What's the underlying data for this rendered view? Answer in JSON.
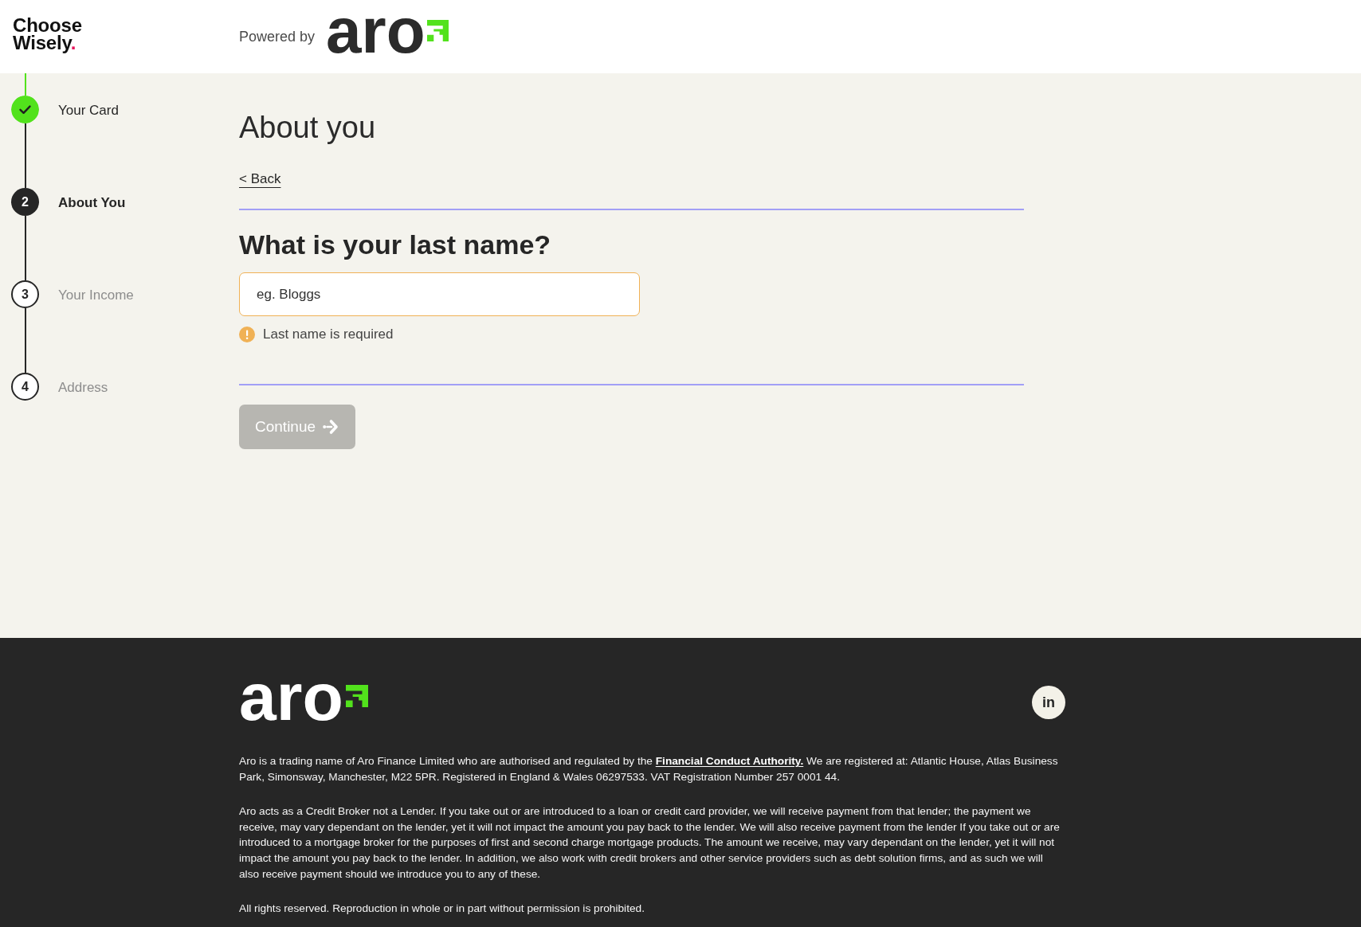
{
  "header": {
    "brand": {
      "name": "Choose Wisely",
      "dot": "."
    },
    "powered_by": "Powered by",
    "partner_logo": {
      "wordmark": "aro"
    }
  },
  "steps": [
    {
      "label": "Your Card",
      "completed": true,
      "current": false
    },
    {
      "number": "2",
      "label": "About You",
      "completed": false,
      "current": true
    },
    {
      "number": "3",
      "label": "Your Income",
      "completed": false,
      "current": false
    },
    {
      "number": "4",
      "label": "Address",
      "completed": false,
      "current": false
    }
  ],
  "form": {
    "title": "About you",
    "back_link": "< Back",
    "question": "What is your last name?",
    "field": {
      "placeholder": "eg. Bloggs",
      "invalid": true
    },
    "error": "Last name is required",
    "continue_button": {
      "label": "Continue",
      "disabled": true
    }
  },
  "footer": {
    "logo": {
      "wordmark": "aro"
    },
    "social_links": [
      {
        "label": "in"
      }
    ],
    "paragraphs": [
      {
        "parts": [
          {
            "kind": "text",
            "text": "Aro is a trading name of Aro Finance Limited who are authorised and regulated by the "
          },
          {
            "kind": "link",
            "text": "Financial Conduct Authority."
          },
          {
            "kind": "text",
            "text": " We are registered at: Atlantic House, Atlas Business Park, Simonsway, Manchester, M22 5PR. Registered in England & Wales 06297533. VAT Registration Number 257 0001 44."
          }
        ]
      },
      {
        "parts": [
          {
            "kind": "text",
            "text": "Aro acts as a Credit Broker not a Lender. If you take out or are introduced to a loan or credit card provider, we will receive payment from that lender; the payment we receive, may vary dependant on the lender, yet it will not impact the amount you pay back to the lender. We will also receive payment from the lender If you take out or are introduced to a mortgage broker for the purposes of first and second charge mortgage products. The amount we receive, may vary dependant on the lender, yet it will not impact the amount you pay back to the lender. In addition, we also work with credit brokers and other service providers such as debt solution firms, and as such we will also receive payment should we introduce you to any of these."
          }
        ]
      },
      {
        "parts": [
          {
            "kind": "text",
            "text": "All rights reserved. Reproduction in whole or in part without permission is prohibited."
          }
        ]
      }
    ]
  }
}
